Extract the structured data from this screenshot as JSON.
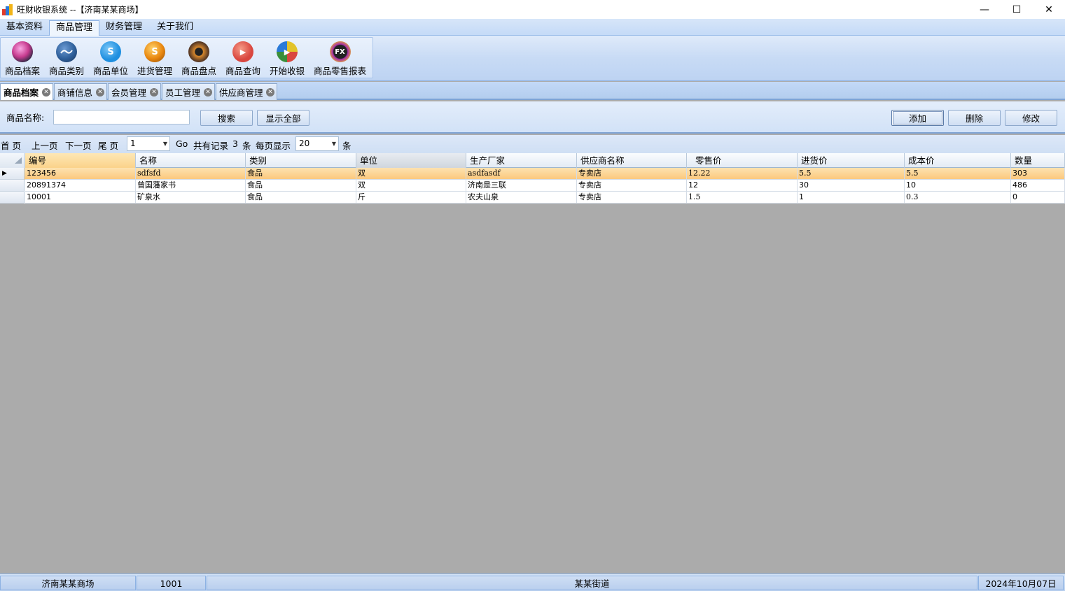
{
  "window": {
    "title": "旺财收银系统 --【济南某某商场】",
    "minimize_glyph": "—",
    "maximize_glyph": "☐",
    "close_glyph": "✕"
  },
  "menu": {
    "tabs": [
      {
        "label": "基本资料"
      },
      {
        "label": "商品管理"
      },
      {
        "label": "财务管理"
      },
      {
        "label": "关于我们"
      }
    ],
    "active": "商品管理"
  },
  "ribbon": {
    "buttons": [
      {
        "label": "商品档案",
        "icon": "product-archive-icon",
        "color": "#c73b8f"
      },
      {
        "label": "商品类别",
        "icon": "product-category-icon",
        "color": "#2e5f9a"
      },
      {
        "label": "商品单位",
        "icon": "product-unit-icon",
        "glyph": "S",
        "color": "#1e8fe0"
      },
      {
        "label": "进货管理",
        "icon": "purchase-icon",
        "glyph": "S",
        "color": "#e8860e"
      },
      {
        "label": "商品盘点",
        "icon": "inventory-icon",
        "color": "#5a3b26"
      },
      {
        "label": "商品查询",
        "icon": "query-icon",
        "glyph": "▶",
        "color": "#d9463f"
      },
      {
        "label": "开始收银",
        "icon": "start-cashier-icon",
        "glyph": "▶",
        "color": "#3a8e3a"
      },
      {
        "label": "商品零售报表",
        "icon": "retail-report-icon",
        "glyph": "FX",
        "color": "#a42aa8"
      }
    ]
  },
  "doc_tabs": [
    {
      "label": "商品档案",
      "active": true
    },
    {
      "label": "商铺信息",
      "active": false
    },
    {
      "label": "会员管理",
      "active": false
    },
    {
      "label": "员工管理",
      "active": false
    },
    {
      "label": "供应商管理",
      "active": false
    }
  ],
  "search": {
    "label": "商品名称:",
    "value": "",
    "search_btn": "搜索",
    "show_all_btn": "显示全部",
    "add_btn": "添加",
    "delete_btn": "删除",
    "edit_btn": "修改"
  },
  "pager": {
    "first": "首  页",
    "prev": "上一页",
    "next": "下一页",
    "last": "尾  页",
    "page_value": "1",
    "go": "Go",
    "total_prefix": "共有记录",
    "total_count": "3",
    "total_suffix": "条",
    "per_page_label": "每页显示",
    "per_page_value": "20",
    "per_page_suffix": "条"
  },
  "table": {
    "columns": [
      "编号",
      "名称",
      "类别",
      "单位",
      "生产厂家",
      "供应商名称",
      "零售价",
      "进货价",
      "成本价",
      "数量"
    ],
    "rows": [
      [
        "123456",
        "sdfsfd",
        "食品",
        "双",
        "asdfasdf",
        "专卖店",
        "12.22",
        "5.5",
        "5.5",
        "303"
      ],
      [
        "20891374",
        "曾国藩家书",
        "食品",
        "双",
        "济南是三联",
        "专卖店",
        "12",
        "30",
        "10",
        "486"
      ],
      [
        "10001",
        "矿泉水",
        "食品",
        "斤",
        "农夫山泉",
        "专卖店",
        "1.5",
        "1",
        "0.3",
        "0"
      ]
    ],
    "selected_row": 0
  },
  "status": {
    "store": "济南某某商场",
    "code": "1001",
    "address": "某某街道",
    "date": "2024年10月07日"
  }
}
